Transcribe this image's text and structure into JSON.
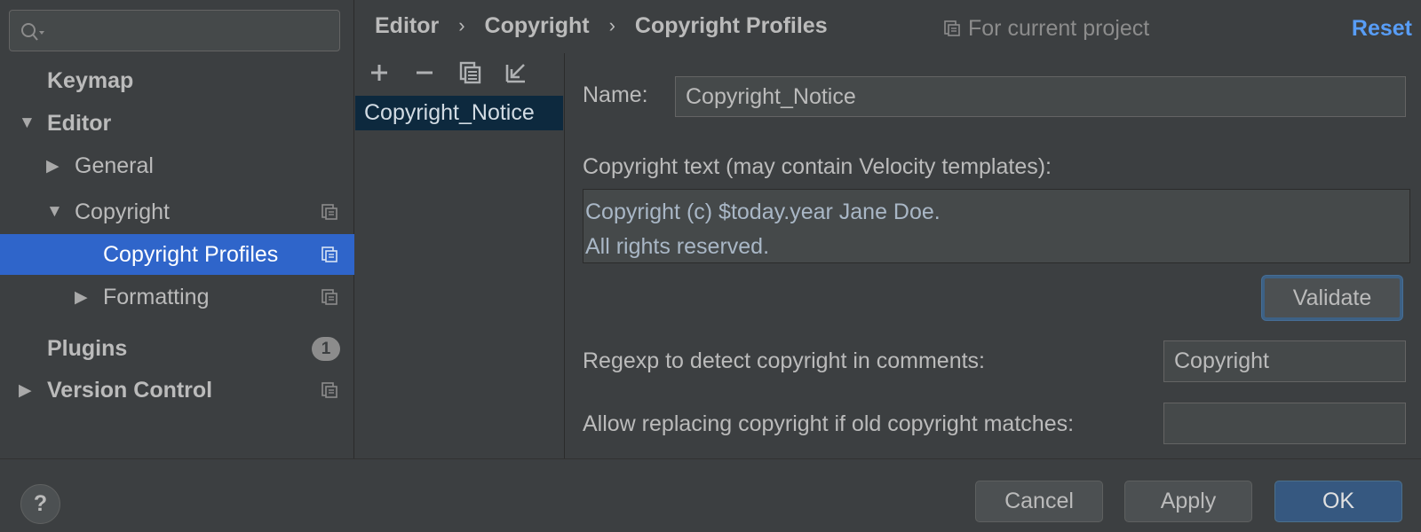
{
  "search": {
    "placeholder": ""
  },
  "sidebar": {
    "items": [
      {
        "label": "Keymap"
      },
      {
        "label": "Editor"
      },
      {
        "label": "General"
      },
      {
        "label": "Copyright"
      },
      {
        "label": "Copyright Profiles"
      },
      {
        "label": "Formatting"
      },
      {
        "label": "Plugins",
        "badge": "1"
      },
      {
        "label": "Version Control"
      }
    ]
  },
  "breadcrumb": {
    "items": [
      "Editor",
      "Copyright",
      "Copyright Profiles"
    ],
    "separator": "›"
  },
  "header": {
    "for_current_project": "For current project",
    "reset_label": "Reset"
  },
  "profiles": {
    "items": [
      {
        "label": "Copyright_Notice"
      }
    ]
  },
  "form": {
    "name_label": "Name:",
    "name_value": "Copyright_Notice",
    "copyright_text_label": "Copyright text (may contain Velocity templates):",
    "copyright_text_lines": [
      "Copyright (c) $today.year Jane Doe.",
      "All rights reserved."
    ],
    "validate_label": "Validate",
    "regexp_label": "Regexp to detect copyright in comments:",
    "regexp_value": "Copyright",
    "allow_replacing_label": "Allow replacing copyright if old copyright matches:",
    "allow_replacing_value": ""
  },
  "footer": {
    "help_label": "?",
    "cancel_label": "Cancel",
    "apply_label": "Apply",
    "ok_label": "OK"
  },
  "colors": {
    "background": "#3c3f41",
    "selection": "#2f65ca",
    "link": "#589df6",
    "ok_button": "#365880",
    "list_selection": "#0d293e"
  }
}
